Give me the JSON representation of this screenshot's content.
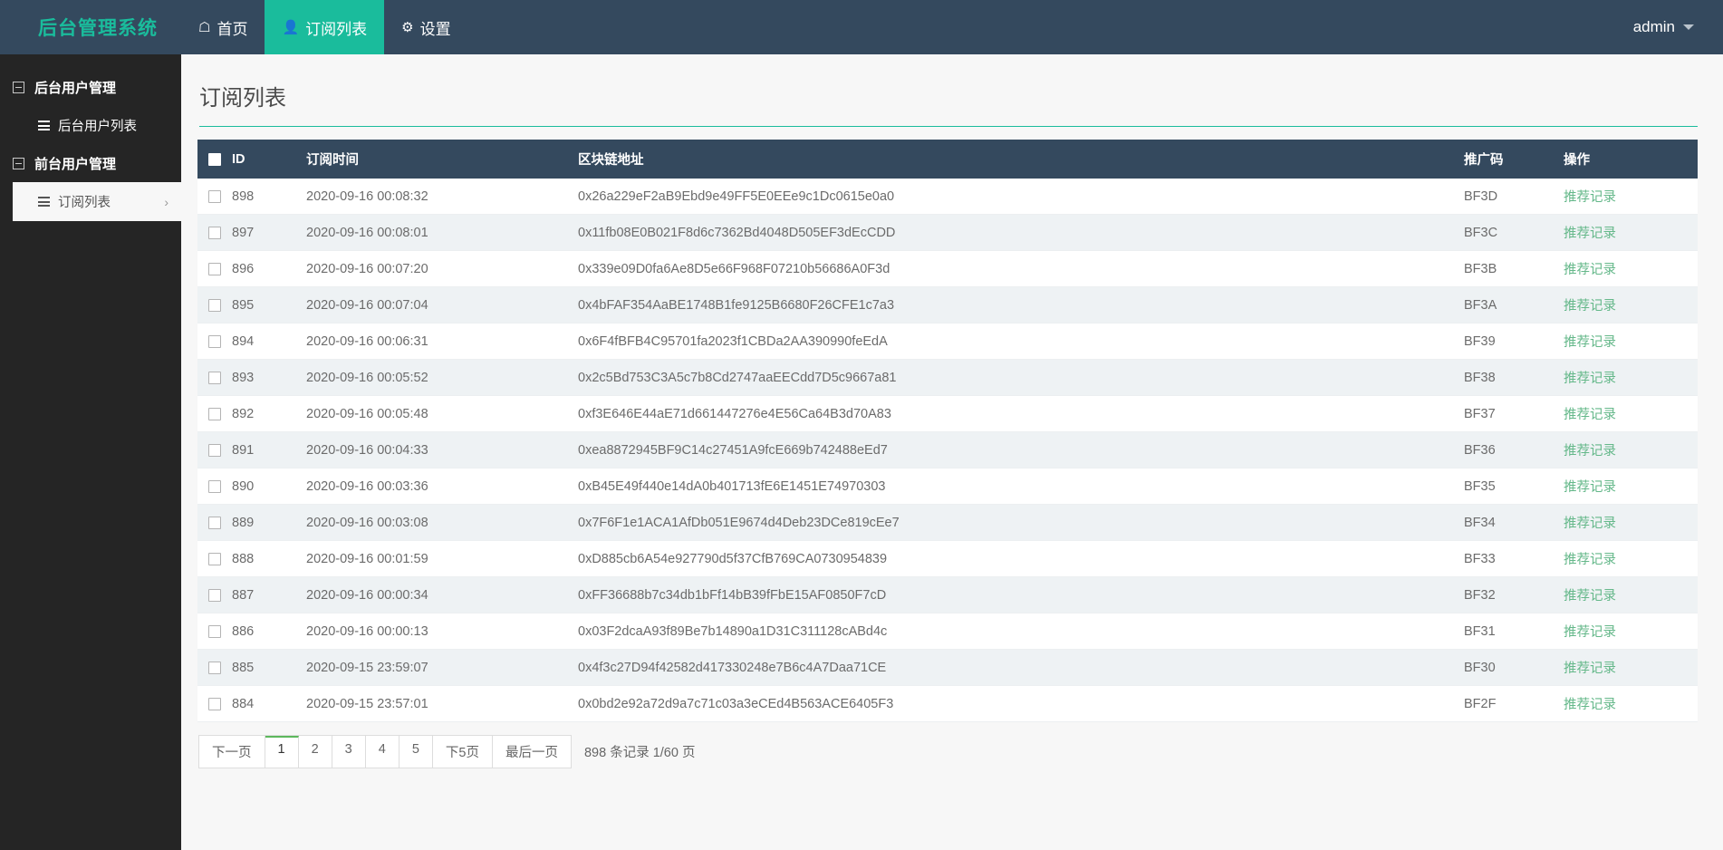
{
  "navbar": {
    "brand": "后台管理系统",
    "items": [
      {
        "label": "首页",
        "icon": "home-icon",
        "glyph": "⌂",
        "active": false
      },
      {
        "label": "订阅列表",
        "icon": "user-icon",
        "glyph": "♟",
        "active": true
      },
      {
        "label": "设置",
        "icon": "gear-icon",
        "glyph": "⚙",
        "active": false
      }
    ],
    "user": "admin"
  },
  "sidebar": {
    "groups": [
      {
        "label": "后台用户管理",
        "items": [
          {
            "label": "后台用户列表",
            "active": false
          }
        ]
      },
      {
        "label": "前台用户管理",
        "items": [
          {
            "label": "订阅列表",
            "active": true,
            "chevron": "›"
          }
        ]
      }
    ]
  },
  "page": {
    "title": "订阅列表"
  },
  "table": {
    "columns": [
      "ID",
      "订阅时间",
      "区块链地址",
      "推广码",
      "操作"
    ],
    "action_label": "推荐记录",
    "rows": [
      {
        "id": "898",
        "time": "2020-09-16 00:08:32",
        "address": "0x26a229eF2aB9Ebd9e49FF5E0EEe9c1Dc0615e0a0",
        "promo": "BF3D"
      },
      {
        "id": "897",
        "time": "2020-09-16 00:08:01",
        "address": "0x11fb08E0B021F8d6c7362Bd4048D505EF3dEcCDD",
        "promo": "BF3C"
      },
      {
        "id": "896",
        "time": "2020-09-16 00:07:20",
        "address": "0x339e09D0fa6Ae8D5e66F968F07210b56686A0F3d",
        "promo": "BF3B"
      },
      {
        "id": "895",
        "time": "2020-09-16 00:07:04",
        "address": "0x4bFAF354AaBE1748B1fe9125B6680F26CFE1c7a3",
        "promo": "BF3A"
      },
      {
        "id": "894",
        "time": "2020-09-16 00:06:31",
        "address": "0x6F4fBFB4C95701fa2023f1CBDa2AA390990feEdA",
        "promo": "BF39"
      },
      {
        "id": "893",
        "time": "2020-09-16 00:05:52",
        "address": "0x2c5Bd753C3A5c7b8Cd2747aaEECdd7D5c9667a81",
        "promo": "BF38"
      },
      {
        "id": "892",
        "time": "2020-09-16 00:05:48",
        "address": "0xf3E646E44aE71d661447276e4E56Ca64B3d70A83",
        "promo": "BF37"
      },
      {
        "id": "891",
        "time": "2020-09-16 00:04:33",
        "address": "0xea8872945BF9C14c27451A9fcE669b742488eEd7",
        "promo": "BF36"
      },
      {
        "id": "890",
        "time": "2020-09-16 00:03:36",
        "address": "0xB45E49f440e14dA0b401713fE6E1451E74970303",
        "promo": "BF35"
      },
      {
        "id": "889",
        "time": "2020-09-16 00:03:08",
        "address": "0x7F6F1e1ACA1AfDb051E9674d4Deb23DCe819cEe7",
        "promo": "BF34"
      },
      {
        "id": "888",
        "time": "2020-09-16 00:01:59",
        "address": "0xD885cb6A54e927790d5f37CfB769CA0730954839",
        "promo": "BF33"
      },
      {
        "id": "887",
        "time": "2020-09-16 00:00:34",
        "address": "0xFF36688b7c34db1bFf14bB39fFbE15AF0850F7cD",
        "promo": "BF32"
      },
      {
        "id": "886",
        "time": "2020-09-16 00:00:13",
        "address": "0x03F2dcaA93f89Be7b14890a1D31C311128cABd4c",
        "promo": "BF31"
      },
      {
        "id": "885",
        "time": "2020-09-15 23:59:07",
        "address": "0x4f3c27D94f42582d417330248e7B6c4A7Daa71CE",
        "promo": "BF30"
      },
      {
        "id": "884",
        "time": "2020-09-15 23:57:01",
        "address": "0x0bd2e92a72d9a7c71c03a3eCEd4B563ACE6405F3",
        "promo": "BF2F"
      }
    ]
  },
  "pagination": {
    "buttons": [
      {
        "label": "下一页",
        "active": false
      },
      {
        "label": "1",
        "active": true
      },
      {
        "label": "2",
        "active": false
      },
      {
        "label": "3",
        "active": false
      },
      {
        "label": "4",
        "active": false
      },
      {
        "label": "5",
        "active": false
      },
      {
        "label": "下5页",
        "active": false
      },
      {
        "label": "最后一页",
        "active": false
      }
    ],
    "info": "898 条记录 1/60 页"
  },
  "colors": {
    "accent": "#1abc9c",
    "navbar": "#34495e",
    "sidebar": "#252525",
    "table_header": "#34495e",
    "link": "#65b88a",
    "page_active_border": "#5cb85c"
  }
}
